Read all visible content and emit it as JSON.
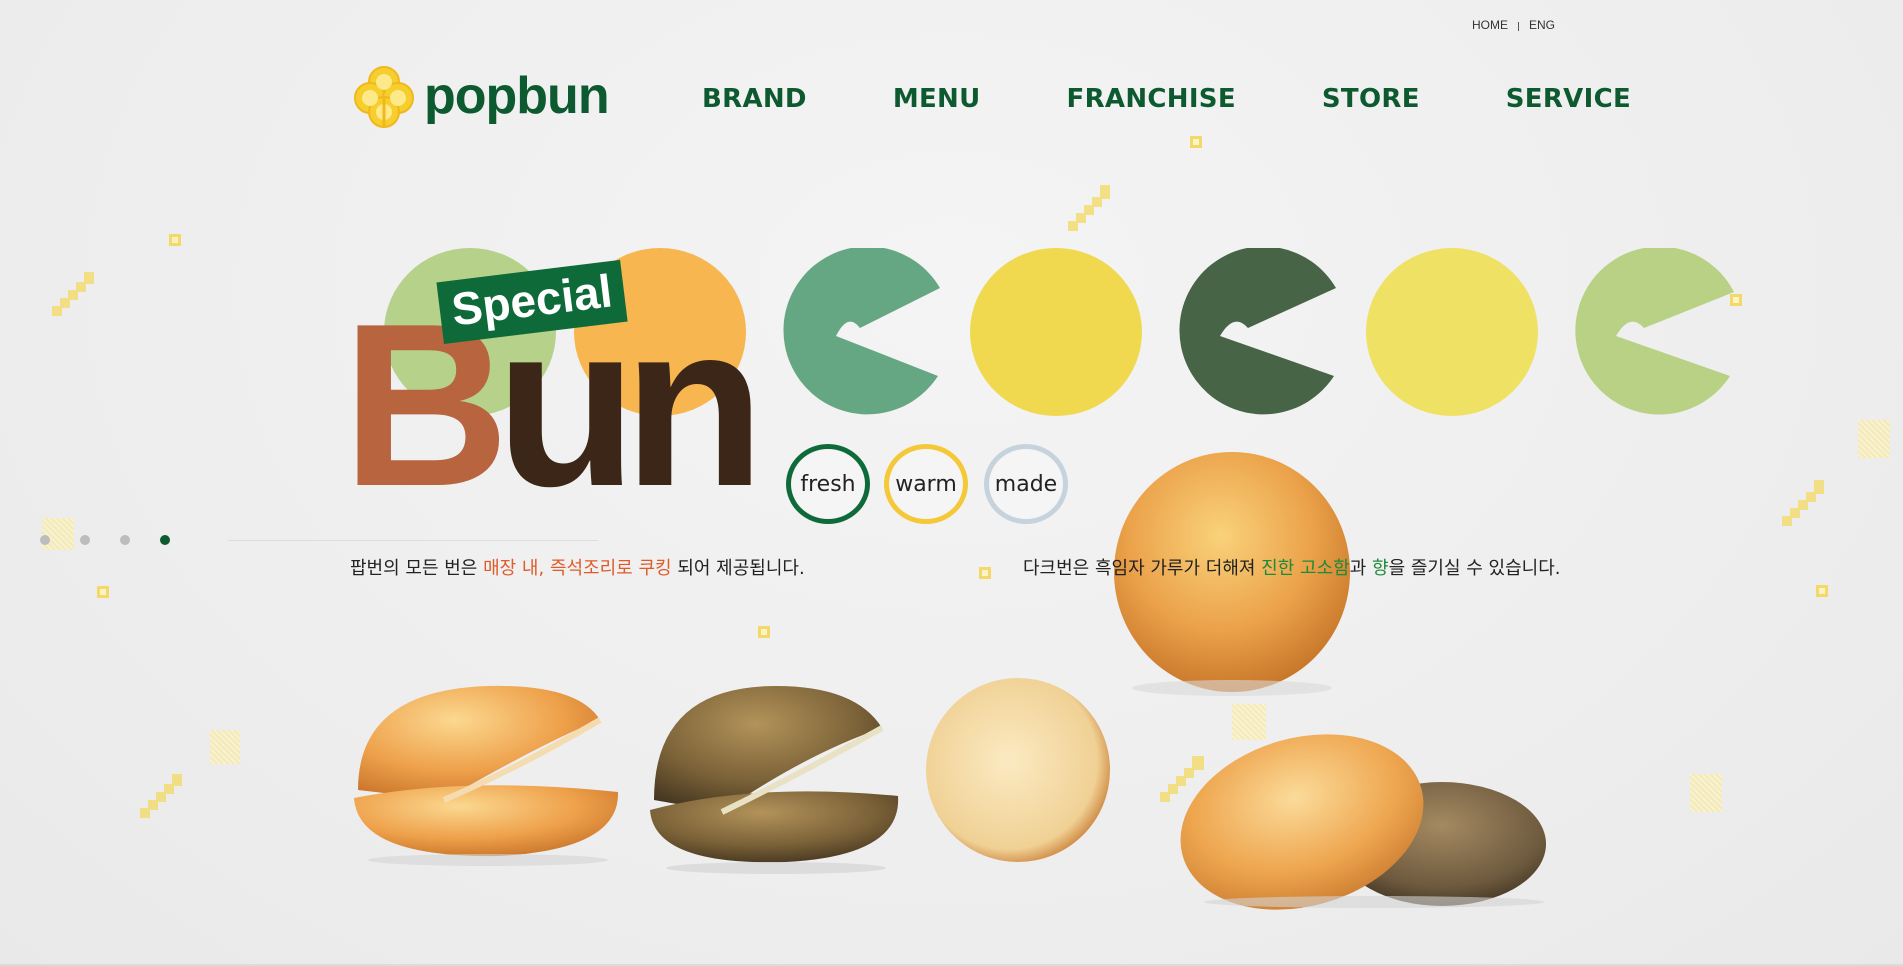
{
  "util_links": {
    "home": "HOME",
    "eng": "ENG"
  },
  "brand": {
    "name": "popbun"
  },
  "nav": [
    "BRAND",
    "MENU",
    "FRANCHISE",
    "STORE",
    "SERVICE"
  ],
  "hero": {
    "badge": "Special",
    "title_b": "B",
    "title_rest": "un",
    "tags": [
      "fresh",
      "warm",
      "made"
    ]
  },
  "left_copy": {
    "part1": "팝번의 모든 번은 ",
    "highlight": "매장 내, 즉석조리로 쿠킹",
    "part2": " 되어 제공됩니다."
  },
  "right_copy": {
    "part1": "다크번은 흑임자 가루가 더해져 ",
    "highlight1": "진한 고소함",
    "part2": "과 ",
    "highlight2": "향",
    "part3": "을 즐기실 수 있습니다."
  },
  "slider": {
    "count": 4,
    "active_index": 3
  },
  "colors": {
    "brand_green": "#0e5a30",
    "circles": [
      "#b5d18a",
      "#f7b64f",
      "#66a783",
      "#f0d84f",
      "#476447",
      "#efe163",
      "#b8d185"
    ],
    "tag_rings": [
      "#0f6a3a",
      "#f4c838",
      "#c6d3dc"
    ]
  }
}
